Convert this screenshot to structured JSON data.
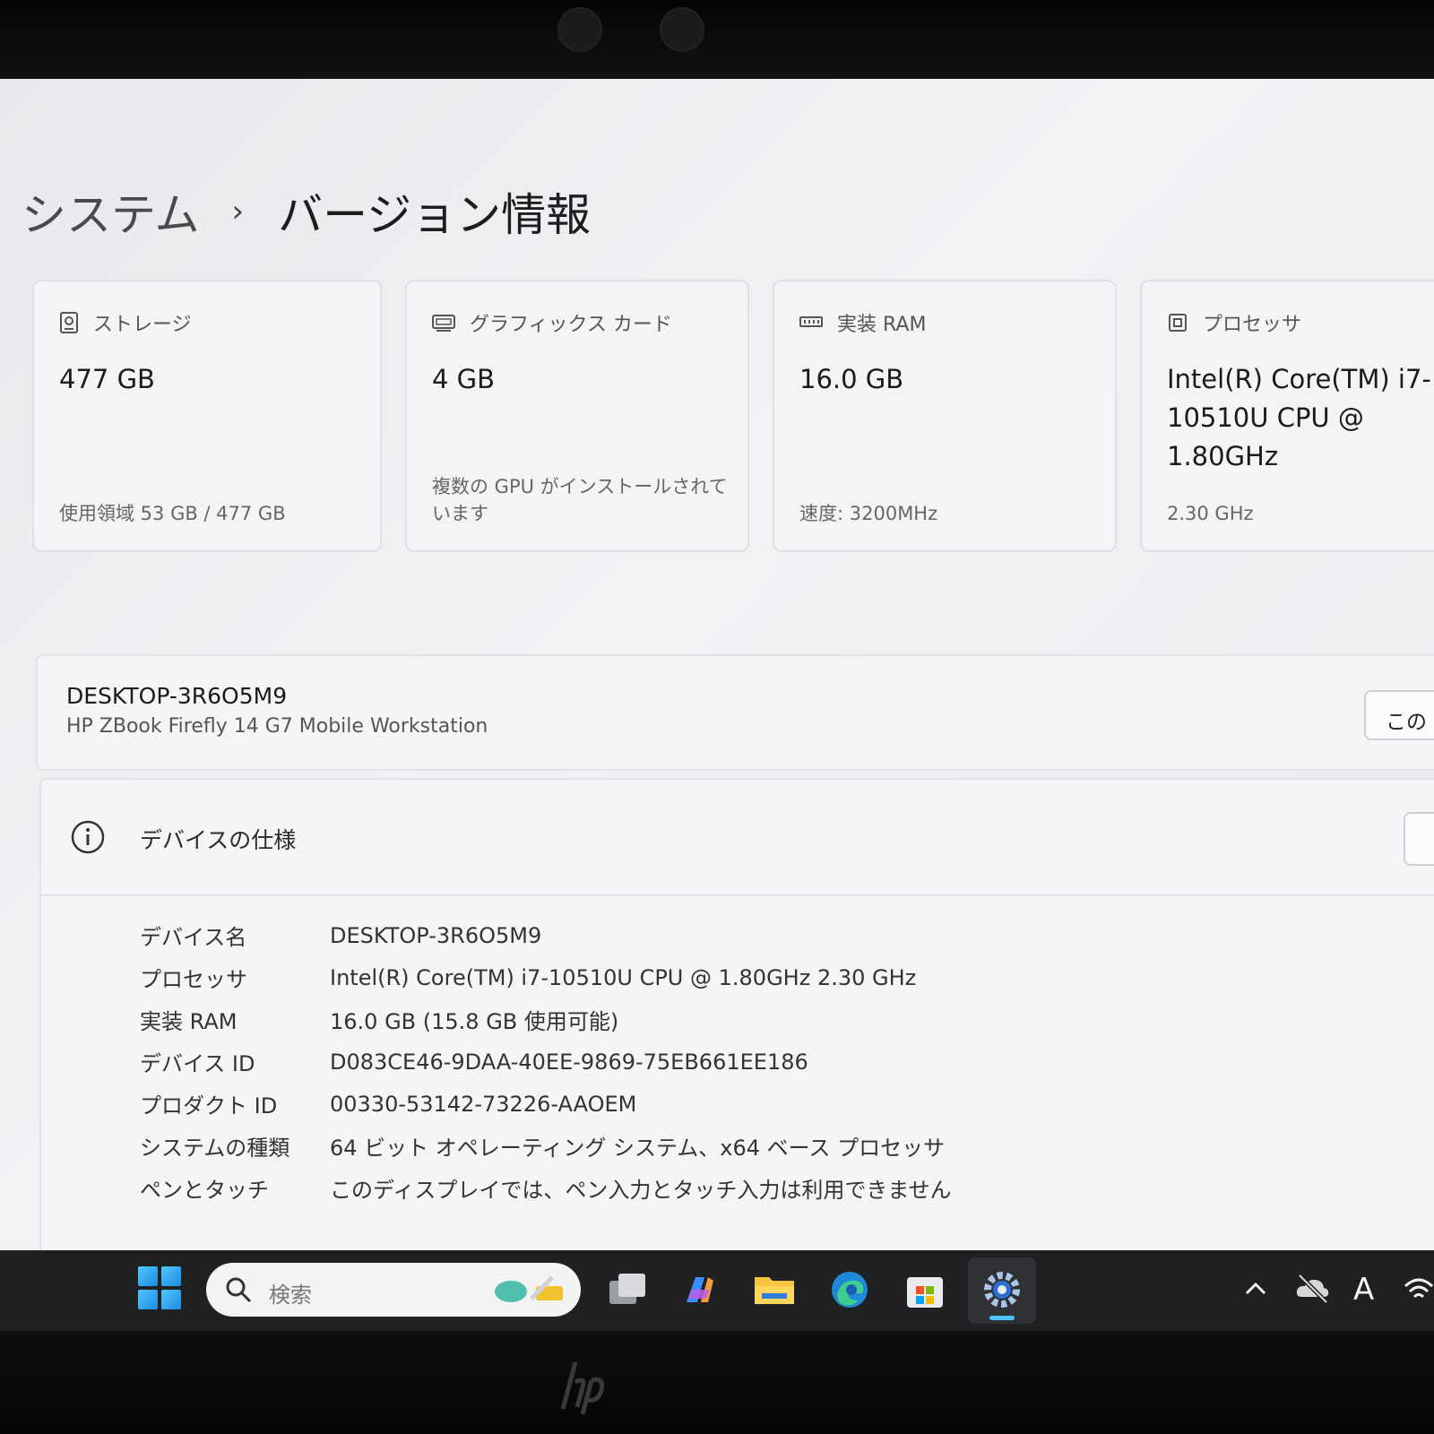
{
  "breadcrumb": {
    "parent": "システム",
    "separator": "›",
    "current": "バージョン情報"
  },
  "cards": [
    {
      "icon": "storage-icon",
      "label": "ストレージ",
      "value": "477 GB",
      "sub": "使用領域 53 GB / 477 GB"
    },
    {
      "icon": "graphics-card-icon",
      "label": "グラフィックス カード",
      "value": "4 GB",
      "sub": "複数の GPU がインストールされています"
    },
    {
      "icon": "ram-icon",
      "label": "実装 RAM",
      "value": "16.0 GB",
      "sub": "速度: 3200MHz"
    },
    {
      "icon": "processor-icon",
      "label": "プロセッサ",
      "value": "Intel(R) Core(TM) i7-10510U CPU @ 1.80GHz",
      "sub": "2.30 GHz"
    }
  ],
  "device_bar": {
    "name": "DESKTOP-3R6O5M9",
    "model": "HP ZBook Firefly 14 G7 Mobile Workstation",
    "rename_button": "この F"
  },
  "spec": {
    "title": "デバイスの仕様",
    "rows": [
      {
        "key": "デバイス名",
        "value": "DESKTOP-3R6O5M9"
      },
      {
        "key": "プロセッサ",
        "value": "Intel(R) Core(TM) i7-10510U CPU @ 1.80GHz   2.30 GHz"
      },
      {
        "key": "実装 RAM",
        "value": "16.0 GB (15.8 GB 使用可能)"
      },
      {
        "key": "デバイス ID",
        "value": "D083CE46-9DAA-40EE-9869-75EB661EE186"
      },
      {
        "key": "プロダクト ID",
        "value": "00330-53142-73226-AAOEM"
      },
      {
        "key": "システムの種類",
        "value": "64 ビット オペレーティング システム、x64 ベース プロセッサ"
      },
      {
        "key": "ペンとタッチ",
        "value": "このディスプレイでは、ペン入力とタッチ入力は利用できません"
      }
    ]
  },
  "taskbar": {
    "search_placeholder": "検索",
    "apps": [
      "task-view-icon",
      "copilot-icon",
      "file-explorer-icon",
      "edge-icon",
      "store-icon",
      "settings-icon"
    ],
    "ime_indicator": "A"
  },
  "colors": {
    "accent": "#4cc2ff",
    "taskbar": "#1f2022"
  }
}
